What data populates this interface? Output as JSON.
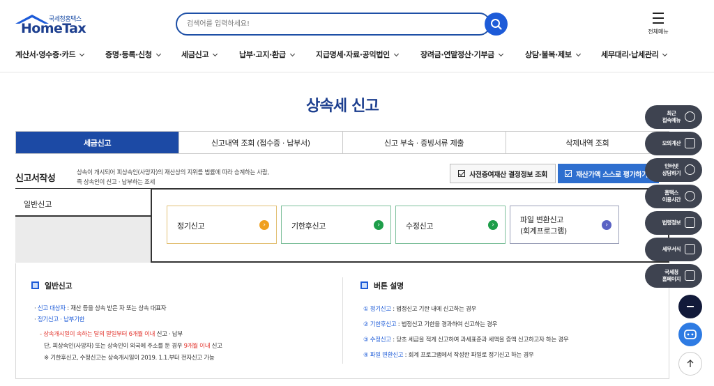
{
  "header": {
    "logo_small": "국세청홈택스",
    "logo_main": "HomeTax",
    "search_placeholder": "검색어를 입력하세요!",
    "menu_label": "전체메뉴"
  },
  "gnb": [
    {
      "label": "계산서·영수증·카드"
    },
    {
      "label": "증명·등록·신청"
    },
    {
      "label": "세금신고"
    },
    {
      "label": "납부·고지·환급"
    },
    {
      "label": "지급명세·자료·공익법인"
    },
    {
      "label": "장려금·연말정산·기부금"
    },
    {
      "label": "상담·불복·제보"
    },
    {
      "label": "세무대리·납세관리"
    }
  ],
  "page_title": "상속세 신고",
  "tabs": [
    {
      "label": "세금신고",
      "active": true
    },
    {
      "label": "신고내역 조회 (접수증 · 납부서)"
    },
    {
      "label": "신고 부속 · 증빙서류 제출"
    },
    {
      "label": "삭제내역 조회"
    }
  ],
  "section": {
    "title": "신고서작성",
    "desc_line1": "상속이 개시되어 피상속인(사망자)의 재산상의 지위를 법률에 따라 승계하는 사람,",
    "desc_line2": "즉 상속인이 신고 · 납부하는 조세",
    "btn_lookup": "사전증여재산 결정정보 조회",
    "btn_self": "재산가액 스스로 평가하기"
  },
  "panel": {
    "tab_label": "일반신고",
    "buttons": [
      {
        "label": "정기신고",
        "color": "#f0a01e"
      },
      {
        "label": "기한후신고",
        "color": "#1e9e4a"
      },
      {
        "label": "수정신고",
        "color": "#1e9e4a"
      },
      {
        "label_line1": "파일 변환신고",
        "label_line2": "(회계프로그램)",
        "color": "#5a62c4"
      }
    ]
  },
  "info_left": {
    "heading": "일반신고",
    "l1_key": "신고 대상자",
    "l1_rest": " : 재산 등을 상속 받은 자 또는 상속 대표자",
    "l2": "정기신고 · 납부기한",
    "l3_red": "상속개시일이 속하는 달의 말일부터 6개월 이내",
    "l3_rest": " 신고 · 납부",
    "l4_a": "단, 피상속인(사망자) 또는 상속인이 외국에 주소를 둔 경우 ",
    "l4_red": "9개월 이내",
    "l4_b": " 신고",
    "l5": "※ 기한후신고, 수정신고는 상속개시일이 2019. 1.1.부터 전자신고 가능"
  },
  "info_right": {
    "heading": "버튼 설명",
    "items": [
      {
        "num": "①",
        "key": "정기신고",
        "rest": " : 법정신고 기한 내에 신고하는 경우"
      },
      {
        "num": "②",
        "key": "기한후신고",
        "rest": " : 법정신고 기한을 경과하여 신고하는 경우"
      },
      {
        "num": "③",
        "key": "수정신고",
        "rest": " : 당초 세금을 적게 신고하여 과세표준과 세액을 증액 신고하고자 하는 경우"
      },
      {
        "num": "④",
        "key": "파일 변환신고",
        "rest": " : 회계 프로그램에서 작성한 파일로 정기신고 하는 경우"
      }
    ]
  },
  "quick_menu": [
    {
      "l1": "최근",
      "l2": "접속메뉴"
    },
    {
      "l1": "모의계산",
      "l2": ""
    },
    {
      "l1": "인터넷",
      "l2": "상담하기"
    },
    {
      "l1": "홈택스",
      "l2": "이용시간"
    },
    {
      "l1": "법령정보",
      "l2": ""
    },
    {
      "l1": "세무서식",
      "l2": ""
    },
    {
      "l1": "국세청",
      "l2": "홈페이지"
    }
  ],
  "colors": {
    "primary": "#1c4aa5",
    "accent_blue": "#2e6fcf",
    "highlight_red": "#e2332c",
    "quick_bg": "#3e4350"
  }
}
